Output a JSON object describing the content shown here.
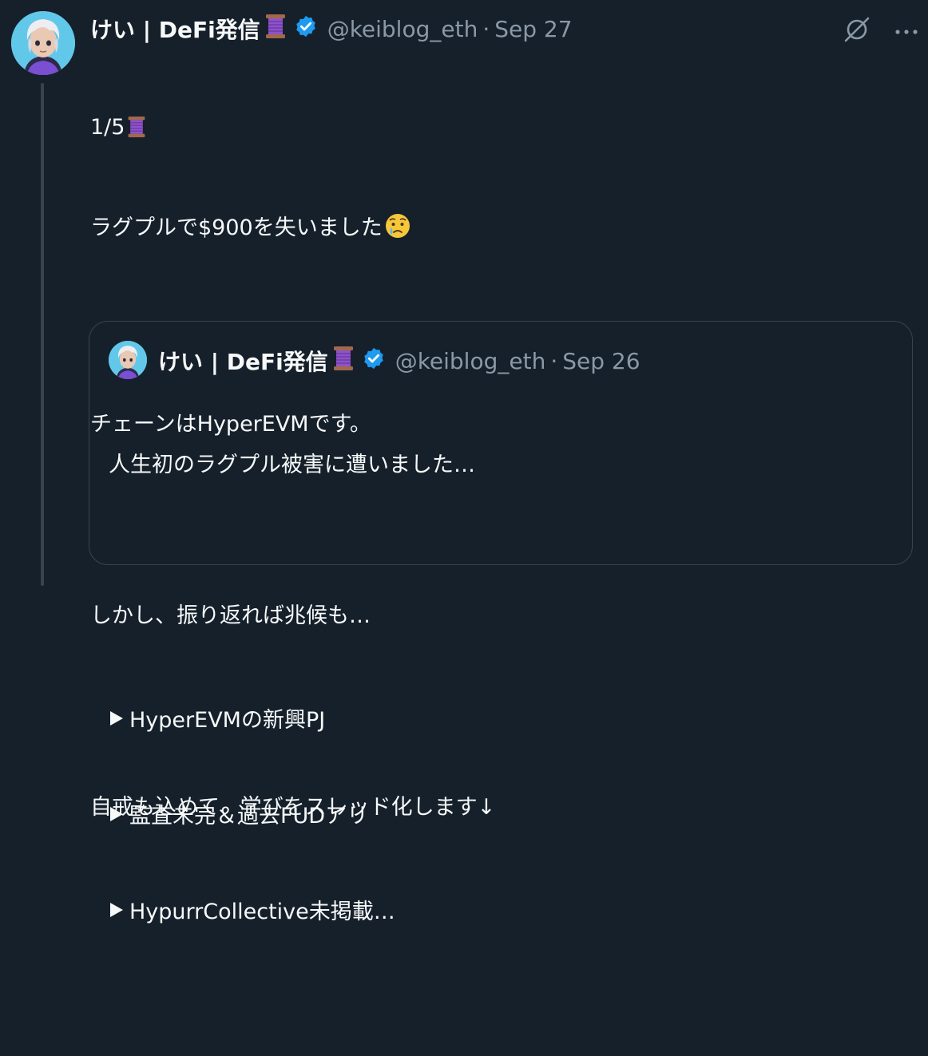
{
  "tweet": {
    "author_name": "けい | DeFi発信",
    "handle": "@keiblog_eth",
    "separator": "·",
    "date": "Sep 27",
    "lines": [
      "1/5",
      "ラグプルで$900を失いました",
      "",
      "チェーンはHyperEVMです。",
      "",
      "しかし、振り返れば兆候も…",
      "",
      "自戒も込めて、学びをスレッド化します↓"
    ]
  },
  "quote": {
    "author_name": "けい | DeFi発信",
    "handle": "@keiblog_eth",
    "separator": "·",
    "date": "Sep 26",
    "intro": "人生初のラグプル被害に遭いました…",
    "items": [
      "HyperEVMの新興PJ",
      "監査未完＆過去FUDアリ",
      "HypurrCollective未掲載…"
    ]
  },
  "icons": {
    "verified_badge": "verified-badge-icon",
    "grok": "grok-icon",
    "more": "more-icon",
    "spool": "thread-spool-emoji",
    "crying": "crying-face-emoji"
  },
  "colors": {
    "background": "#15202b",
    "text": "#f7f9f9",
    "muted": "#8b98a5",
    "border": "#38444d",
    "verified": "#1d9bf0"
  }
}
